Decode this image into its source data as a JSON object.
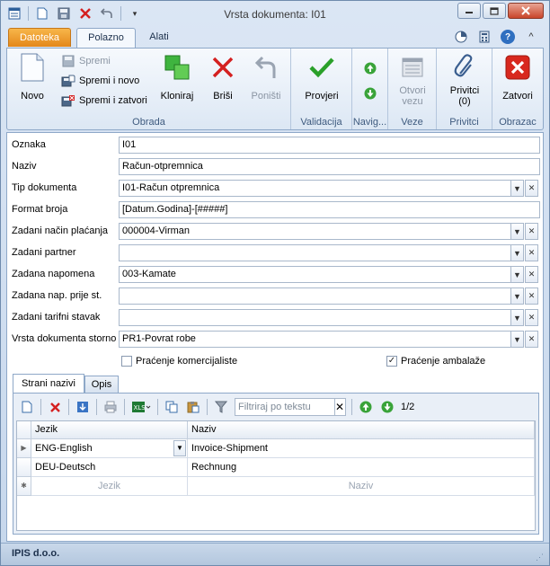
{
  "window": {
    "title": "Vrsta dokumenta: I01"
  },
  "ribbon_tabs": [
    "Datoteka",
    "Polazno",
    "Alati"
  ],
  "ribbon": {
    "novo": "Novo",
    "spremi": "Spremi",
    "spremi_i_novo": "Spremi i novo",
    "spremi_i_zatvori": "Spremi i zatvori",
    "kloniraj": "Kloniraj",
    "brisi": "Briši",
    "ponisti": "Poništi",
    "provjeri": "Provjeri",
    "otvori_vezu_1": "Otvori",
    "otvori_vezu_2": "vezu",
    "privitci_1": "Privitci",
    "privitci_2": "(0)",
    "zatvori": "Zatvori",
    "groups": {
      "obrada": "Obrada",
      "validacija": "Validacija",
      "navig": "Navig...",
      "veze": "Veze",
      "privitci": "Privitci",
      "obrazac": "Obrazac"
    }
  },
  "form": {
    "oznaka": {
      "label": "Oznaka",
      "value": "I01"
    },
    "naziv": {
      "label": "Naziv",
      "value": "Račun-otpremnica"
    },
    "tip_dokumenta": {
      "label": "Tip dokumenta",
      "value": "I01-Račun otpremnica"
    },
    "format_broja": {
      "label": "Format broja",
      "value": "[Datum.Godina]-[#####]"
    },
    "nacin_placanja": {
      "label": "Zadani način plaćanja",
      "value": "000004-Virman"
    },
    "partner": {
      "label": "Zadani partner",
      "value": ""
    },
    "napomena": {
      "label": "Zadana napomena",
      "value": "003-Kamate"
    },
    "nap_prije": {
      "label": "Zadana nap. prije st.",
      "value": ""
    },
    "tarifni": {
      "label": "Zadani tarifni stavak",
      "value": ""
    },
    "storno": {
      "label": "Vrsta dokumenta storno",
      "value": "PR1-Povrat robe"
    },
    "pracenje_komercijaliste": {
      "label": "Praćenje komercijaliste",
      "checked": false
    },
    "pracenje_ambalaze": {
      "label": "Praćenje ambalaže",
      "checked": true
    }
  },
  "subtabs": [
    "Strani nazivi",
    "Opis"
  ],
  "grid_toolbar": {
    "filter_placeholder": "Filtriraj po tekstu",
    "page": "1/2"
  },
  "grid": {
    "columns": [
      "Jezik",
      "Naziv"
    ],
    "rows": [
      {
        "jezik": "ENG-English",
        "naziv": "Invoice-Shipment"
      },
      {
        "jezik": "DEU-Deutsch",
        "naziv": "Rechnung"
      }
    ],
    "new_row_placeholders": [
      "Jezik",
      "Naziv"
    ]
  },
  "status": {
    "company": "IPIS d.o.o."
  }
}
